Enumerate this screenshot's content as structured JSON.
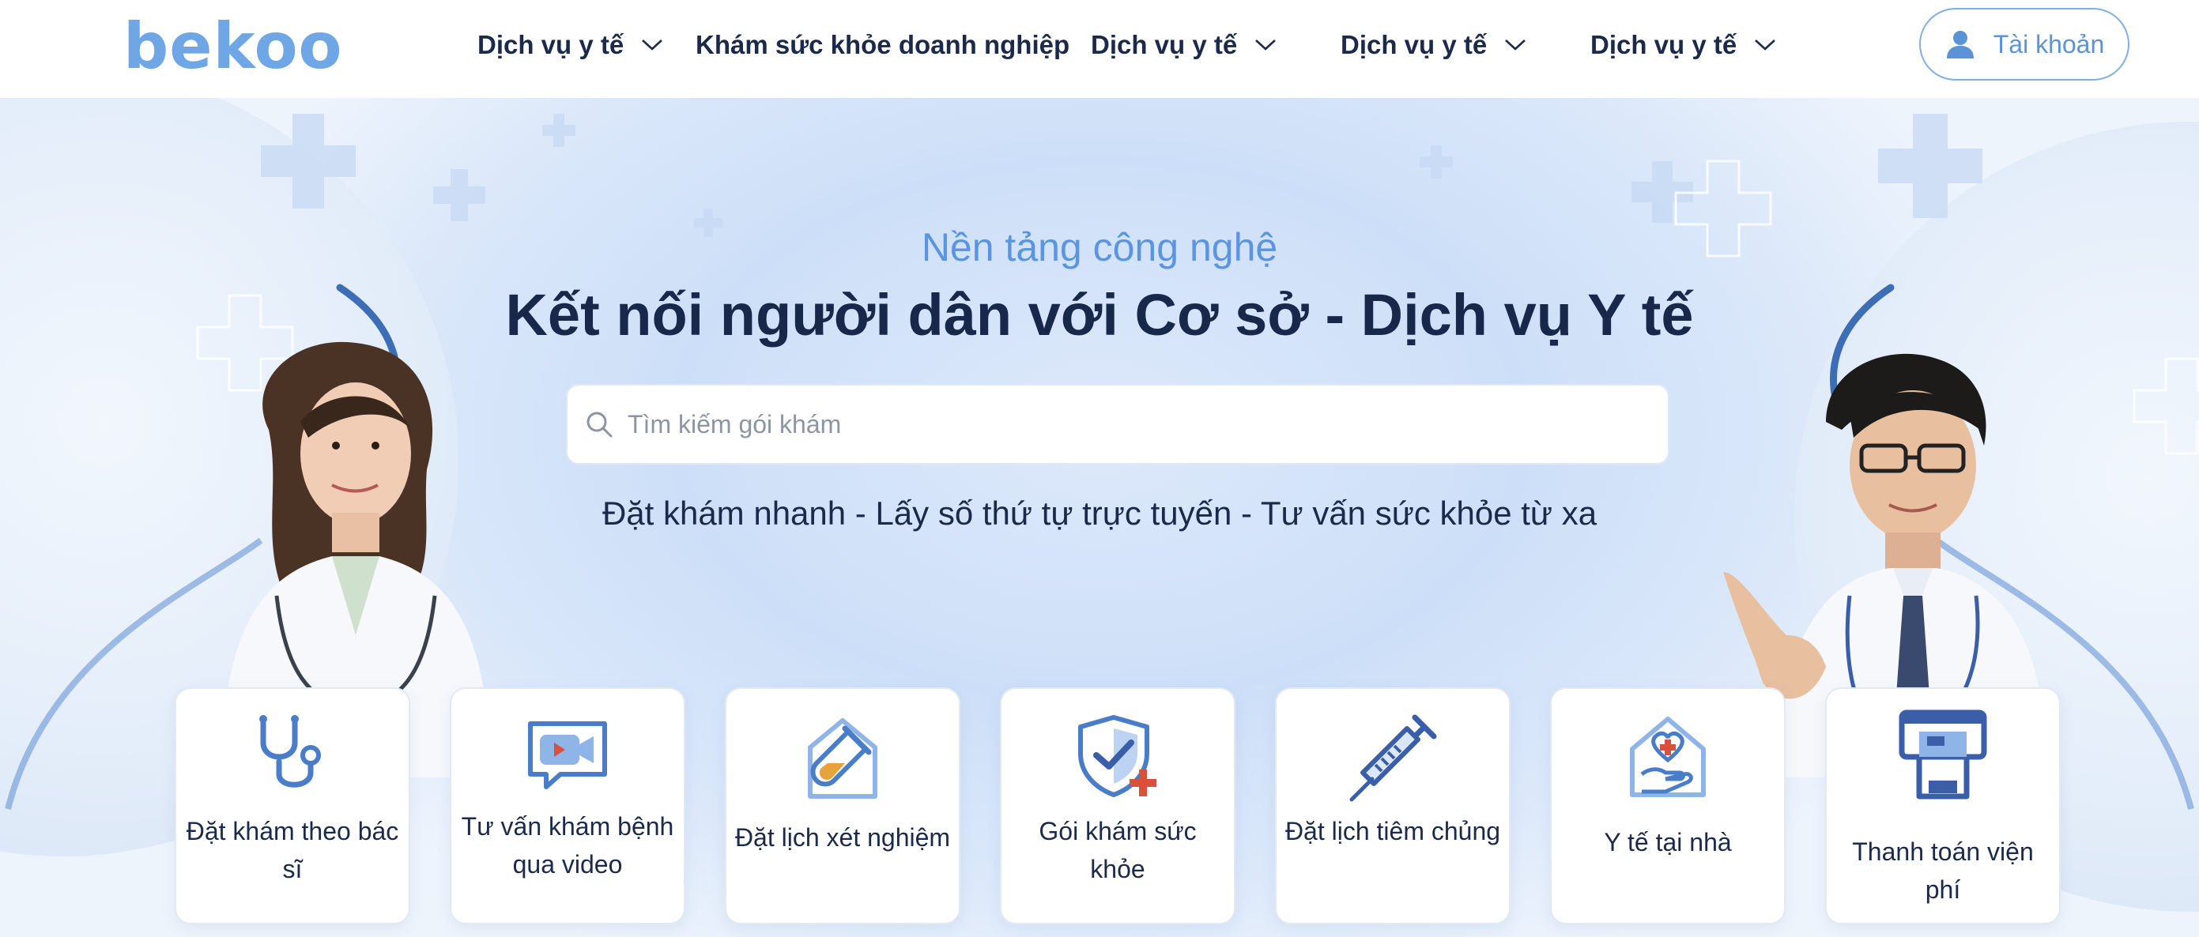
{
  "header": {
    "logo": "bekoo",
    "nav": [
      {
        "label": "Dịch vụ y tế",
        "has_dropdown": true
      },
      {
        "label": "Khám sức khỏe doanh nghiệp",
        "has_dropdown": false
      },
      {
        "label": "Dịch vụ y tế",
        "has_dropdown": true
      },
      {
        "label": "Dịch vụ y tế",
        "has_dropdown": true
      },
      {
        "label": "Dịch vụ y tế",
        "has_dropdown": true
      }
    ],
    "account_label": "Tài khoản",
    "account_icon": "user-icon"
  },
  "hero": {
    "subtitle": "Nền tảng công nghệ",
    "title": "Kết nối người dân với Cơ sở - Dịch vụ Y tế",
    "search": {
      "placeholder": "Tìm kiếm gói khám",
      "value": "",
      "icon": "search-icon"
    },
    "tagline": "Đặt khám nhanh - Lấy số thứ tự trực tuyến - Tư vấn sức khỏe từ xa"
  },
  "services": [
    {
      "label": "Đặt khám theo bác sĩ",
      "icon": "stethoscope-icon"
    },
    {
      "label": "Tư vấn khám bệnh qua video",
      "icon": "video-call-icon"
    },
    {
      "label": "Đặt lịch xét nghiệm",
      "icon": "test-tube-icon"
    },
    {
      "label": "Gói khám sức khỏe",
      "icon": "shield-check-icon"
    },
    {
      "label": "Đặt lịch tiêm chủng",
      "icon": "syringe-icon"
    },
    {
      "label": "Y tế tại nhà",
      "icon": "home-care-icon"
    },
    {
      "label": "Thanh toán viện phí",
      "icon": "payment-terminal-icon"
    }
  ],
  "colors": {
    "brand": "#6fa6e6",
    "text_dark": "#1b2a4a",
    "accent_blue": "#5b95e0",
    "icon_blue": "#4a7dc8",
    "icon_red": "#d9503c",
    "icon_orange": "#e8a23a"
  }
}
